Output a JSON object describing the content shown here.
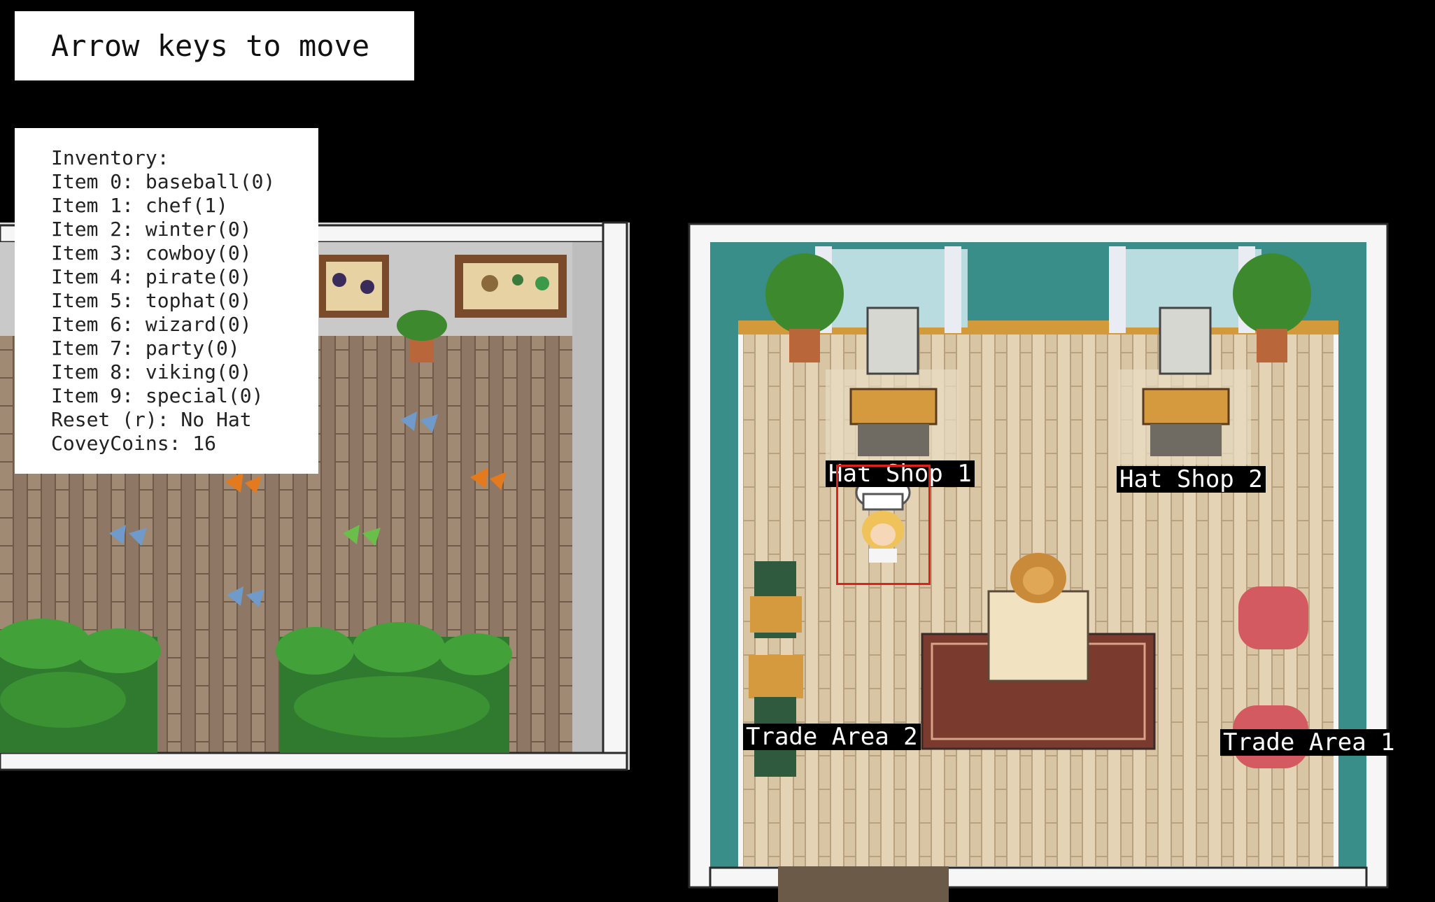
{
  "help": {
    "text": "Arrow keys to move"
  },
  "inventory": {
    "title": "Inventory:",
    "items": [
      "Item 0: baseball(0)",
      "Item 1: chef(1)",
      "Item 2: winter(0)",
      "Item 3: cowboy(0)",
      "Item 4: pirate(0)",
      "Item 5: tophat(0)",
      "Item 6: wizard(0)",
      "Item 7: party(0)",
      "Item 8: viking(0)",
      "Item 9: special(0)"
    ],
    "reset": "Reset (r): No Hat",
    "coins": "CoveyCoins: 16"
  },
  "labels": {
    "hat_shop_1": "Hat Shop 1",
    "hat_shop_2": "Hat Shop 2",
    "trade_area_2": "Trade Area 2",
    "trade_area_1": "Trade Area 1"
  },
  "player": {
    "hat": "chef"
  },
  "colors": {
    "background": "#000000",
    "floor": "#d9c7a6",
    "wall_teal": "#3a8e8a",
    "frame": "#f3f3f3",
    "highlight": "#e0201a"
  }
}
